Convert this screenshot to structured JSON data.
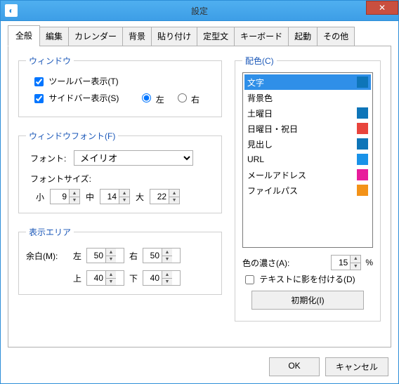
{
  "window": {
    "title": "設定"
  },
  "tabs": [
    "全般",
    "編集",
    "カレンダー",
    "背景",
    "貼り付け",
    "定型文",
    "キーボード",
    "起動",
    "その他"
  ],
  "active_tab": 0,
  "groups": {
    "window_group": "ウィンドウ",
    "font_group": "ウィンドウフォント(F)",
    "display_group": "表示エリア",
    "color_group": "配色(C)"
  },
  "window_opts": {
    "toolbar_label": "ツールバー表示(T)",
    "sidebar_label": "サイドバー表示(S)",
    "toolbar_checked": true,
    "sidebar_checked": true,
    "radio_left": "左",
    "radio_right": "右",
    "radio_value": "left"
  },
  "font": {
    "label": "フォント:",
    "value": "メイリオ",
    "size_label": "フォントサイズ:",
    "small": "小",
    "small_val": 9,
    "mid": "中",
    "mid_val": 14,
    "large": "大",
    "large_val": 22
  },
  "display": {
    "margin_label": "余白(M):",
    "left": "左",
    "left_val": 50,
    "right": "右",
    "right_val": 50,
    "top": "上",
    "top_val": 40,
    "bottom": "下",
    "bottom_val": 40
  },
  "colors": [
    {
      "label": "文字",
      "color": "#0e75b8",
      "selected": true
    },
    {
      "label": "背景色",
      "color": null
    },
    {
      "label": "土曜日",
      "color": "#0e75b8"
    },
    {
      "label": "日曜日・祝日",
      "color": "#e8443c"
    },
    {
      "label": "見出し",
      "color": "#0e75b8"
    },
    {
      "label": "URL",
      "color": "#1992e8"
    },
    {
      "label": "メールアドレス",
      "color": "#e81c9b"
    },
    {
      "label": "ファイルパス",
      "color": "#f39218"
    }
  ],
  "color_opts": {
    "opacity_label": "色の濃さ(A):",
    "opacity_val": 15,
    "opacity_unit": "%",
    "shadow_label": "テキストに影を付ける(D)",
    "reset_label": "初期化(I)"
  },
  "footer": {
    "ok": "OK",
    "cancel": "キャンセル"
  }
}
